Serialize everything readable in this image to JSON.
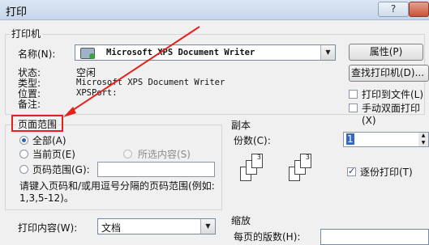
{
  "window": {
    "title": "打印",
    "help_label": "?"
  },
  "printer": {
    "group_title": "打印机",
    "name_label": "名称(N):",
    "name_value": "Microsoft XPS Document Writer",
    "properties_button": "属性(P)",
    "find_printer_button": "查找打印机(D)...",
    "status_label": "状态:",
    "status_value": "空闲",
    "type_label": "类型:",
    "type_value": "Microsoft XPS Document Writer",
    "location_label": "位置:",
    "location_value": "XPSPort:",
    "comment_label": "备注:",
    "print_to_file_label": "打印到文件(L)",
    "manual_duplex_label": "手动双面打印(X)"
  },
  "page_range": {
    "group_title": "页面范围",
    "all_label": "全部(A)",
    "current_page_label": "当前页(E)",
    "selection_label": "所选内容(S)",
    "pages_label": "页码范围(G):",
    "pages_value": "",
    "hint": "请键入页码和/或用逗号分隔的页码范围(例如: 1,3,5-12)。"
  },
  "copies": {
    "group_title": "副本",
    "count_label": "份数(C):",
    "count_value": "1",
    "collate_label": "逐份打印(T)"
  },
  "print_what": {
    "label": "打印内容(W):",
    "value": "文档"
  },
  "zoom": {
    "group_title": "缩放",
    "per_sheet_label": "每页的版数(H):"
  },
  "colors": {
    "annotation": "#e3231b",
    "selection": "#2b63b8"
  }
}
